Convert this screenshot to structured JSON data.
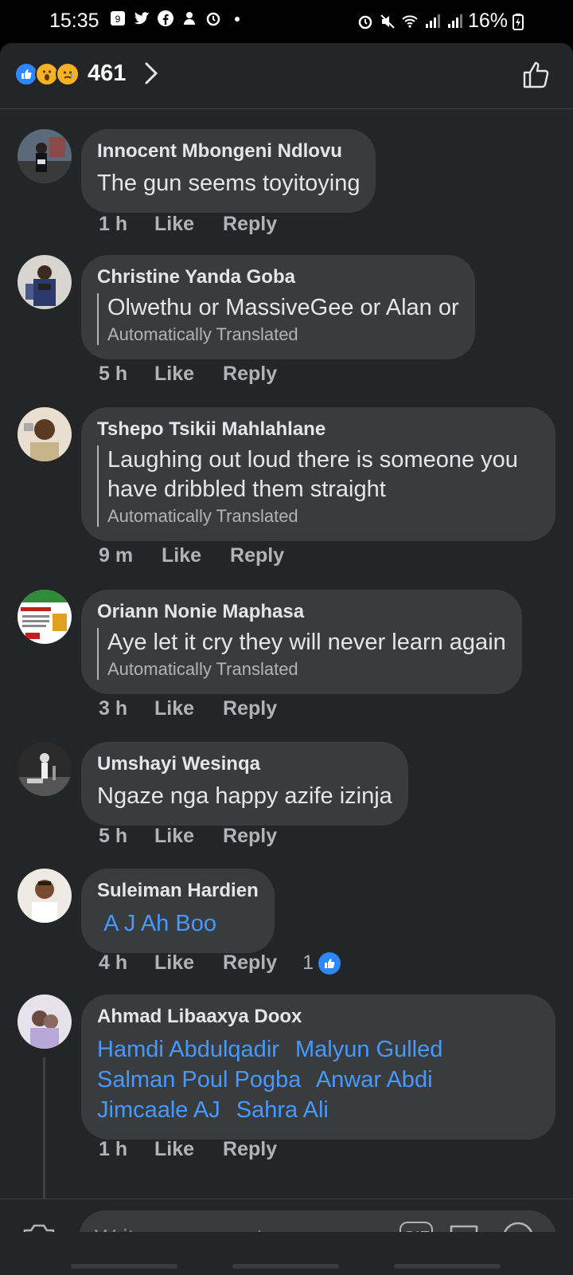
{
  "status_bar": {
    "time": "15:35",
    "battery": "16%"
  },
  "reactions": {
    "count": "461",
    "types": [
      "like",
      "wow",
      "sad"
    ]
  },
  "comments": [
    {
      "author": "Innocent Mbongeni Ndlovu",
      "text": "The gun seems toyitoying",
      "time": "1 h",
      "like": "Like",
      "reply": "Reply"
    },
    {
      "author": "Christine Yanda Goba",
      "text": "Olwethu or MassiveGee or Alan or",
      "translated_note": "Automatically Translated",
      "time": "5 h",
      "like": "Like",
      "reply": "Reply"
    },
    {
      "author": "Tshepo Tsikii Mahlahlane",
      "text": "Laughing out loud there is someone you have dribbled them straight",
      "translated_note": "Automatically Translated",
      "time": "9 m",
      "like": "Like",
      "reply": "Reply"
    },
    {
      "author": "Oriann Nonie Maphasa",
      "text": "Aye let it cry they will never learn again",
      "translated_note": "Automatically Translated",
      "time": "3 h",
      "like": "Like",
      "reply": "Reply"
    },
    {
      "author": "Umshayi Wesinqa",
      "text": "Ngaze nga happy azife izinja",
      "time": "5 h",
      "like": "Like",
      "reply": "Reply"
    },
    {
      "author": "Suleiman Hardien",
      "tags": [
        "A J Ah Boo"
      ],
      "time": "4 h",
      "like": "Like",
      "reply": "Reply",
      "like_count": "1"
    },
    {
      "author": "Ahmad Libaaxya Doox",
      "tags": [
        "Hamdi Abdulqadir",
        "Malyun Gulled",
        "Salman Poul Pogba",
        "Anwar Abdi",
        "Jimcaale AJ",
        "Sahra Ali"
      ],
      "time": "1 h",
      "like": "Like",
      "reply": "Reply"
    }
  ],
  "composer": {
    "placeholder": "Write a comment...",
    "gif_label": "GIF"
  },
  "colors": {
    "background": "#242526",
    "bubble": "#3a3b3c",
    "link": "#4599ff",
    "like_blue": "#2d88ff"
  }
}
